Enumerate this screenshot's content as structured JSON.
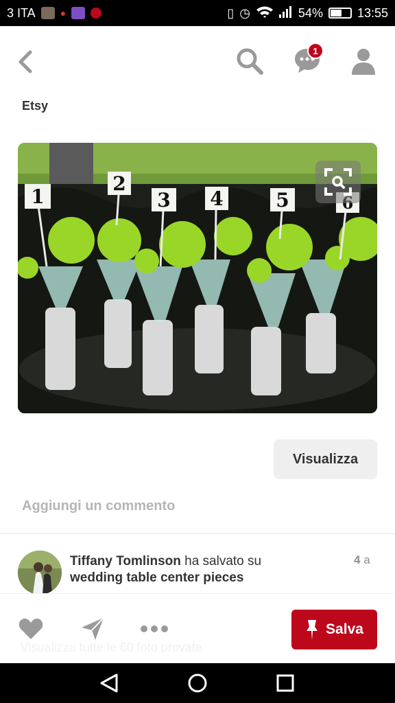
{
  "status": {
    "carrier": "3 ITA",
    "battery_percent": "54%",
    "battery_level": 0.54,
    "time": "13:55"
  },
  "topbar": {
    "notification_count": "1",
    "icons": [
      "back-icon",
      "search-icon",
      "chat-icon",
      "profile-icon"
    ]
  },
  "pin": {
    "source": "Etsy",
    "photo_numbers": [
      "1",
      "2",
      "3",
      "4",
      "5",
      "6"
    ],
    "view_button": "Visualizza",
    "comment_placeholder": "Aggiungi un commento"
  },
  "activity": {
    "user": "Tiffany Tomlinson",
    "action": "ha salvato su",
    "board": "wedding table center pieces",
    "time_value": "4",
    "time_unit": "a"
  },
  "actions": {
    "save_label": "Salva",
    "ghost_text": "Visualizza tutte le 60 foto provate"
  },
  "colors": {
    "accent": "#bd081c",
    "statusbar": "#000000",
    "icon_gray": "#9a9a9a"
  }
}
